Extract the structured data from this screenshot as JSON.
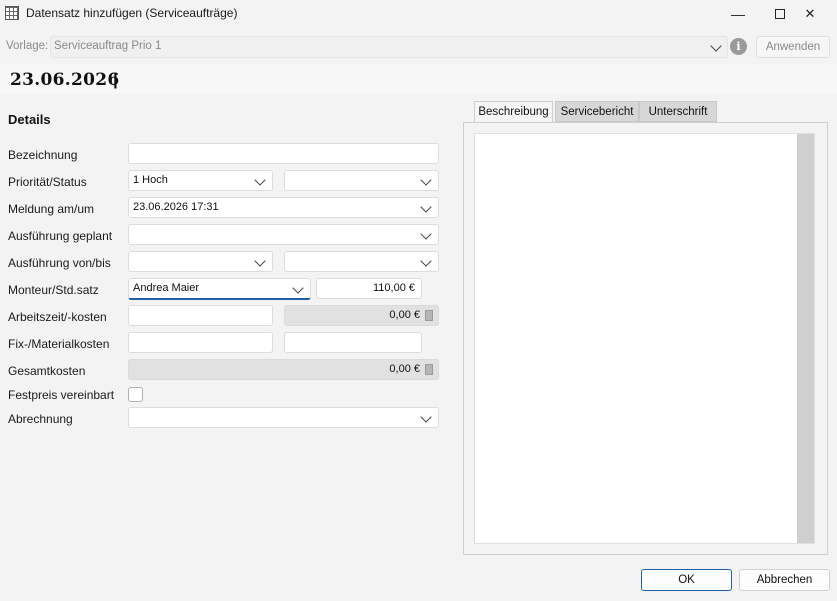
{
  "window": {
    "title": "Datensatz hinzufügen (Serviceaufträge)",
    "minimize_glyph": "—",
    "maximize_glyph": "☐",
    "close_glyph": "✕"
  },
  "template": {
    "label": "Vorlage:",
    "value": "Serviceauftrag Prio 1",
    "info_glyph": "i",
    "apply_label": "Anwenden"
  },
  "header": {
    "date": "23.06.2026",
    "caret": "|"
  },
  "details": {
    "heading": "Details",
    "labels": {
      "bezeichnung": "Bezeichnung",
      "prioritaet": "Priorität/Status",
      "meldung": "Meldung am/um",
      "ausfuehrung_geplant": "Ausführung geplant",
      "ausfuehrung_von_bis": "Ausführung von/bis",
      "monteur": "Monteur/Std.satz",
      "arbeitszeit": "Arbeitszeit/-kosten",
      "fix_material": "Fix-/Materialkosten",
      "gesamtkosten": "Gesamtkosten",
      "festpreis": "Festpreis vereinbart",
      "abrechnung": "Abrechnung"
    },
    "values": {
      "bezeichnung": "",
      "prioritaet": "1 Hoch",
      "status": "",
      "meldung": "23.06.2026 17:31",
      "ausfuehrung_geplant": "",
      "ausfuehrung_von": "",
      "ausfuehrung_bis": "",
      "monteur": "Andrea Maier",
      "stundensatz": "110,00 €",
      "arbeitszeit": "",
      "arbeitskosten": "0,00 €",
      "fixkosten": "",
      "materialkosten": "",
      "gesamtkosten": "0,00 €",
      "festpreis_checked": false,
      "abrechnung": ""
    }
  },
  "tabs": [
    {
      "label": "Beschreibung",
      "active": true
    },
    {
      "label": "Servicebericht",
      "active": false
    },
    {
      "label": "Unterschrift",
      "active": false
    }
  ],
  "buttons": {
    "ok": "OK",
    "cancel": "Abbrechen"
  },
  "colors": {
    "accent": "#1f5fa8",
    "background": "#f3f3f3"
  }
}
